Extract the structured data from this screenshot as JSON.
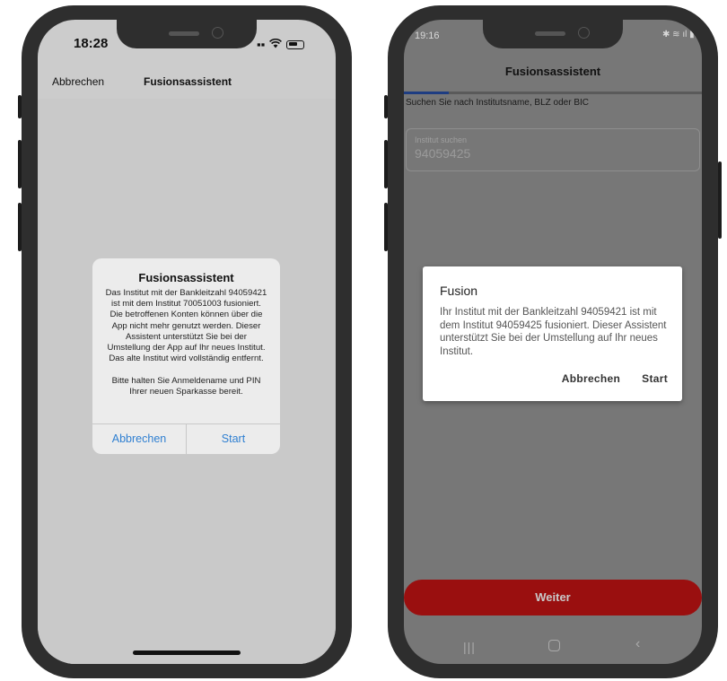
{
  "ios": {
    "status_time": "18:28",
    "nav": {
      "cancel": "Abbrechen",
      "title": "Fusionsassistent"
    },
    "alert": {
      "title": "Fusionsassistent",
      "body": "Das Institut mit der Bankleitzahl 94059421 ist mit dem Institut 70051003 fusioniert. Die betroffenen Konten können über die App nicht mehr genutzt werden. Dieser Assistent unterstützt Sie bei der Umstellung der App auf Ihr neues Institut. Das alte Institut wird vollständig entfernt.\n\nBitte halten Sie Anmeldename und PIN Ihrer neuen Sparkasse bereit.",
      "cancel_button": "Abbrechen",
      "start_button": "Start"
    }
  },
  "android": {
    "status_time": "19:16",
    "title": "Fusionsassistent",
    "helper_text": "Suchen Sie nach Institutsname, BLZ oder BIC",
    "search_field": {
      "label": "Institut suchen",
      "value": "94059425"
    },
    "dialog": {
      "title": "Fusion",
      "body": "Ihr Institut mit der Bankleitzahl 94059421 ist mit dem Institut 94059425 fusioniert. Dieser Assistent unterstützt Sie bei der Umstellung auf Ihr neues Institut.",
      "cancel_button": "Abbrechen",
      "start_button": "Start"
    },
    "continue_button": "Weiter",
    "progress_fraction": 0.15
  },
  "colors": {
    "ios_link": "#2f7fd1",
    "android_primary_button": "#9a0f0f",
    "android_progress": "#1e3d82"
  }
}
